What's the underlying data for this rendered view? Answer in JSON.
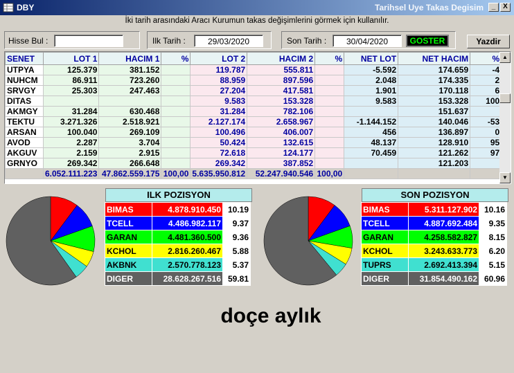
{
  "window": {
    "icon": "grid-app-icon",
    "title": "DBY",
    "right_title": "Tarihsel Uye Takas Degisim",
    "minimize_label": "_",
    "close_label": "X"
  },
  "hint": "İki tarih arasındaki  Aracı Kurumun takas değişimlerini görmek için kullanılır.",
  "form": {
    "search_label": "Hisse Bul :",
    "search_value": "",
    "start_label": "Ilk Tarih :",
    "start_value": "29/03/2020",
    "end_label": "Son Tarih :",
    "end_value": "30/04/2020",
    "show_button": "GOSTER",
    "print_button": "Yazdir"
  },
  "grid": {
    "headers": [
      "SENET",
      "LOT 1",
      "HACIM 1",
      "%",
      "LOT 2",
      "HACIM 2",
      "%",
      "NET LOT",
      "NET HACIM",
      "%"
    ],
    "rows": [
      [
        "UTPYA",
        "125.379",
        "381.152",
        "",
        "119.787",
        "555.811",
        "",
        "-5.592",
        "174.659",
        "-4"
      ],
      [
        "NUHCM",
        "86.911",
        "723.260",
        "",
        "88.959",
        "897.596",
        "",
        "2.048",
        "174.335",
        "2"
      ],
      [
        "SRVGY",
        "25.303",
        "247.463",
        "",
        "27.204",
        "417.581",
        "",
        "1.901",
        "170.118",
        "6"
      ],
      [
        "DITAS",
        "",
        "",
        "",
        "9.583",
        "153.328",
        "",
        "9.583",
        "153.328",
        "100"
      ],
      [
        "AKMGY",
        "31.284",
        "630.468",
        "",
        "31.284",
        "782.106",
        "",
        "",
        "151.637",
        ""
      ],
      [
        "TEKTU",
        "3.271.326",
        "2.518.921",
        "",
        "2.127.174",
        "2.658.967",
        "",
        "-1.144.152",
        "140.046",
        "-53"
      ],
      [
        "ARSAN",
        "100.040",
        "269.109",
        "",
        "100.496",
        "406.007",
        "",
        "456",
        "136.897",
        "0"
      ],
      [
        "AVOD",
        "2.287",
        "3.704",
        "",
        "50.424",
        "132.615",
        "",
        "48.137",
        "128.910",
        "95"
      ],
      [
        "AKGUV",
        "2.159",
        "2.915",
        "",
        "72.618",
        "124.177",
        "",
        "70.459",
        "121.262",
        "97"
      ],
      [
        "GRNYO",
        "269.342",
        "266.648",
        "",
        "269.342",
        "387.852",
        "",
        "",
        "121.203",
        ""
      ]
    ],
    "totals": [
      "",
      "6.052.111.223",
      "47.862.559.175",
      "100,00",
      "5.635.950.812",
      "52.247.940.546",
      "100,00",
      "",
      "",
      ""
    ]
  },
  "ilk_pozisyon": {
    "title": "ILK POZISYON",
    "rows": [
      {
        "name": "BIMAS",
        "value": "4.878.910.450",
        "pct": "10.19",
        "color": "#ff0000",
        "text": "#ffffff"
      },
      {
        "name": "TCELL",
        "value": "4.486.982.117",
        "pct": "9.37",
        "color": "#0000ff",
        "text": "#ffffff"
      },
      {
        "name": "GARAN",
        "value": "4.481.360.500",
        "pct": "9.36",
        "color": "#00ff00",
        "text": "#000000"
      },
      {
        "name": "KCHOL",
        "value": "2.816.260.467",
        "pct": "5.88",
        "color": "#ffff00",
        "text": "#000000"
      },
      {
        "name": "AKBNK",
        "value": "2.570.778.123",
        "pct": "5.37",
        "color": "#40e0d0",
        "text": "#000000"
      },
      {
        "name": "DIGER",
        "value": "28.628.267.516",
        "pct": "59.81",
        "color": "#606060",
        "text": "#ffffff"
      }
    ]
  },
  "son_pozisyon": {
    "title": "SON POZISYON",
    "rows": [
      {
        "name": "BIMAS",
        "value": "5.311.127.902",
        "pct": "10.16",
        "color": "#ff0000",
        "text": "#ffffff"
      },
      {
        "name": "TCELL",
        "value": "4.887.692.484",
        "pct": "9.35",
        "color": "#0000ff",
        "text": "#ffffff"
      },
      {
        "name": "GARAN",
        "value": "4.258.582.827",
        "pct": "8.15",
        "color": "#00ff00",
        "text": "#000000"
      },
      {
        "name": "KCHOL",
        "value": "3.243.633.773",
        "pct": "6.20",
        "color": "#ffff00",
        "text": "#000000"
      },
      {
        "name": "TUPRS",
        "value": "2.692.413.394",
        "pct": "5.15",
        "color": "#40e0d0",
        "text": "#000000"
      },
      {
        "name": "DIGER",
        "value": "31.854.490.162",
        "pct": "60.96",
        "color": "#606060",
        "text": "#ffffff"
      }
    ]
  },
  "member_name": "doçe aylık"
}
